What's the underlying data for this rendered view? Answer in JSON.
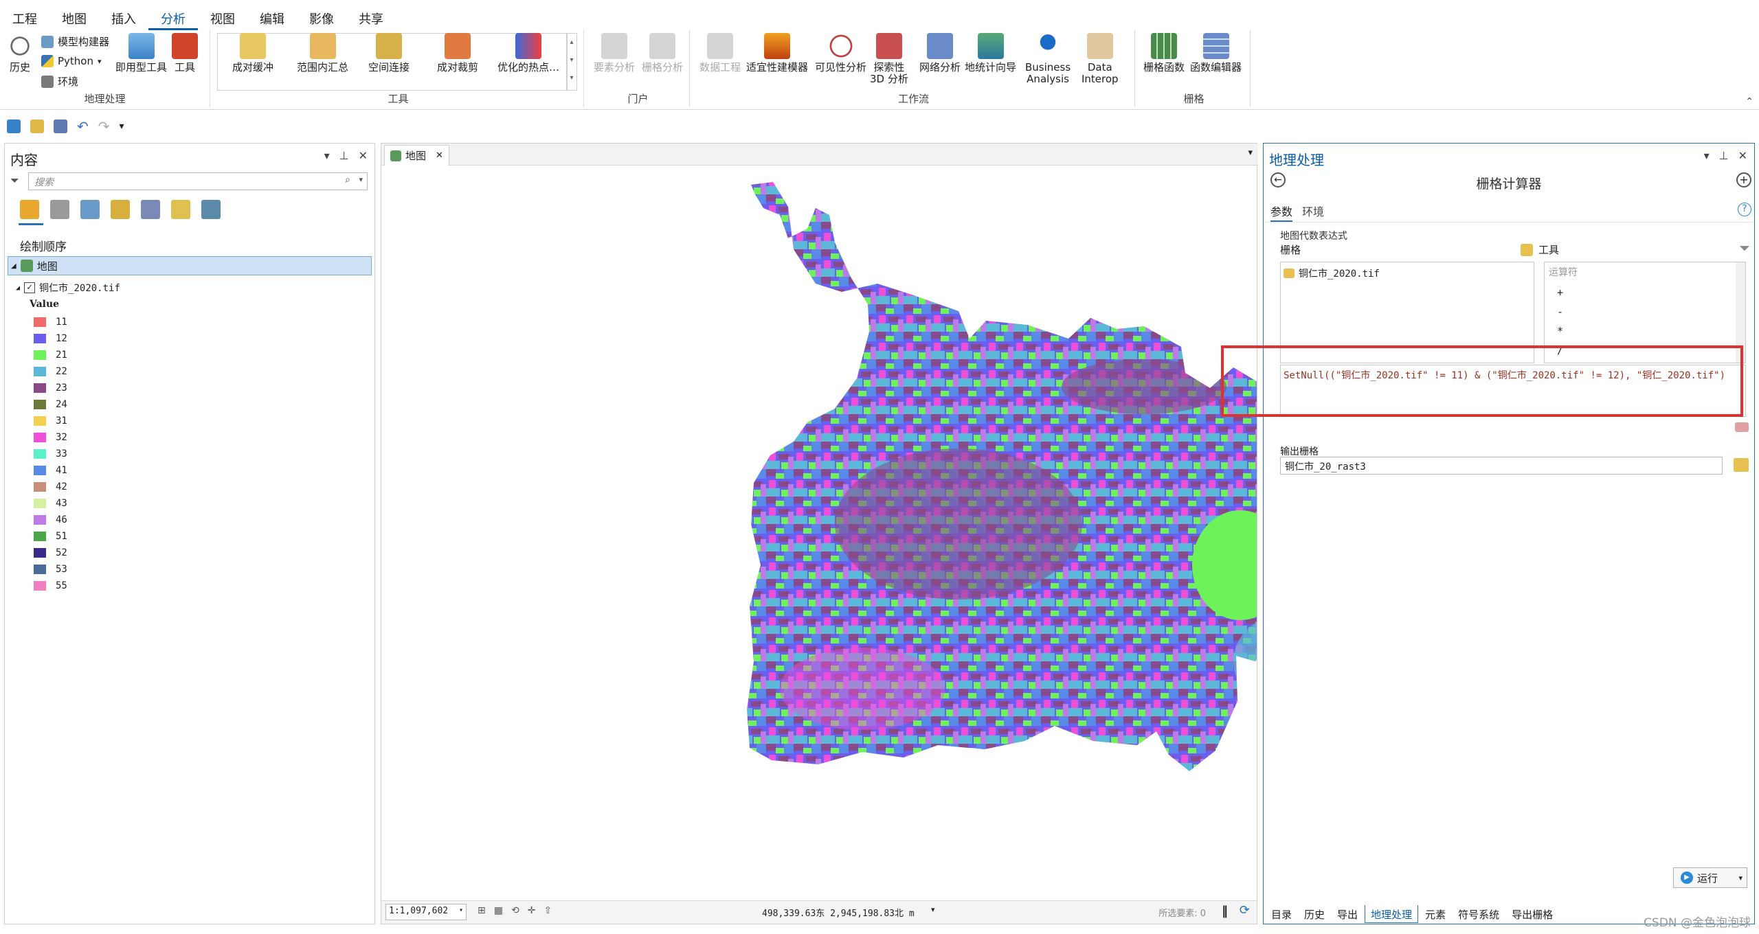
{
  "ribbon": {
    "tabs": [
      "工程",
      "地图",
      "插入",
      "分析",
      "视图",
      "编辑",
      "影像",
      "共享"
    ],
    "active_tab": "分析",
    "geoprocessing_group": {
      "label": "地理处理",
      "history": "历史",
      "model_builder": "模型构建器",
      "python": "Python",
      "environments": "环境",
      "ready_tools": "即用型工具",
      "tools": "工具"
    },
    "tools_group": {
      "label": "工具",
      "items": [
        "成对缓冲",
        "范围内汇总",
        "空间连接",
        "成对裁剪",
        "优化的热点…"
      ]
    },
    "portal_group": {
      "label": "门户",
      "items": [
        "要素分析",
        "栅格分析"
      ]
    },
    "workflow_group": {
      "label": "工作流",
      "items": [
        "数据工程",
        "适宜性建模器",
        "可见性分析",
        "探索性\n3D 分析",
        "网络分析",
        "地统计向导",
        "Business\nAnalysis",
        "Data\nInterop"
      ]
    },
    "raster_group": {
      "label": "栅格",
      "items": [
        "栅格函数",
        "函数编辑器"
      ]
    }
  },
  "contents": {
    "title": "内容",
    "search_placeholder": "搜索",
    "draw_order": "绘制顺序",
    "map_item": "地图",
    "layer_name": "铜仁市_2020.tif",
    "value_header": "Value",
    "legend": [
      {
        "label": "11",
        "color": "#f26a6a"
      },
      {
        "label": "12",
        "color": "#6a5ef0"
      },
      {
        "label": "21",
        "color": "#6ef25a"
      },
      {
        "label": "22",
        "color": "#5cb8d8"
      },
      {
        "label": "23",
        "color": "#8a4a8a"
      },
      {
        "label": "24",
        "color": "#6a7a3a"
      },
      {
        "label": "31",
        "color": "#f4d050"
      },
      {
        "label": "32",
        "color": "#f050d8"
      },
      {
        "label": "33",
        "color": "#5af0c8"
      },
      {
        "label": "41",
        "color": "#5a8ae8"
      },
      {
        "label": "42",
        "color": "#c8907a"
      },
      {
        "label": "43",
        "color": "#d4f0a0"
      },
      {
        "label": "46",
        "color": "#c07ae8"
      },
      {
        "label": "51",
        "color": "#4aa84a"
      },
      {
        "label": "52",
        "color": "#3a2a8a"
      },
      {
        "label": "53",
        "color": "#4a6a9a"
      },
      {
        "label": "55",
        "color": "#f080c0"
      }
    ]
  },
  "map": {
    "tab_label": "地图",
    "scale": "1:1,097,602",
    "coords": "498,339.63东 2,945,198.83北 m",
    "selected_features": "所选要素: 0"
  },
  "geoprocessing": {
    "title": "地理处理",
    "tool_name": "栅格计算器",
    "tab_params": "参数",
    "tab_env": "环境",
    "map_algebra_label": "地图代数表达式",
    "rasters_label": "栅格",
    "tools_label": "工具",
    "raster_item": "铜仁市_2020.tif",
    "operators_placeholder": "运算符",
    "operators": [
      "+",
      "-",
      "*",
      "/"
    ],
    "expression": "SetNull((\"铜仁市_2020.tif\" != 11) & (\"铜仁市_2020.tif\" != 12), \"铜仁_2020.tif\")",
    "output_label": "输出栅格",
    "output_value": "铜仁市_20_rast3",
    "run": "运行"
  },
  "bottom_tabs": [
    "目录",
    "历史",
    "导出",
    "地理处理",
    "元素",
    "符号系统",
    "导出栅格"
  ],
  "bottom_active": "地理处理",
  "watermark": "CSDN @金色泡泡球",
  "colors": {
    "accent": "#0a5ea8",
    "highlight_box": "#e03030"
  }
}
